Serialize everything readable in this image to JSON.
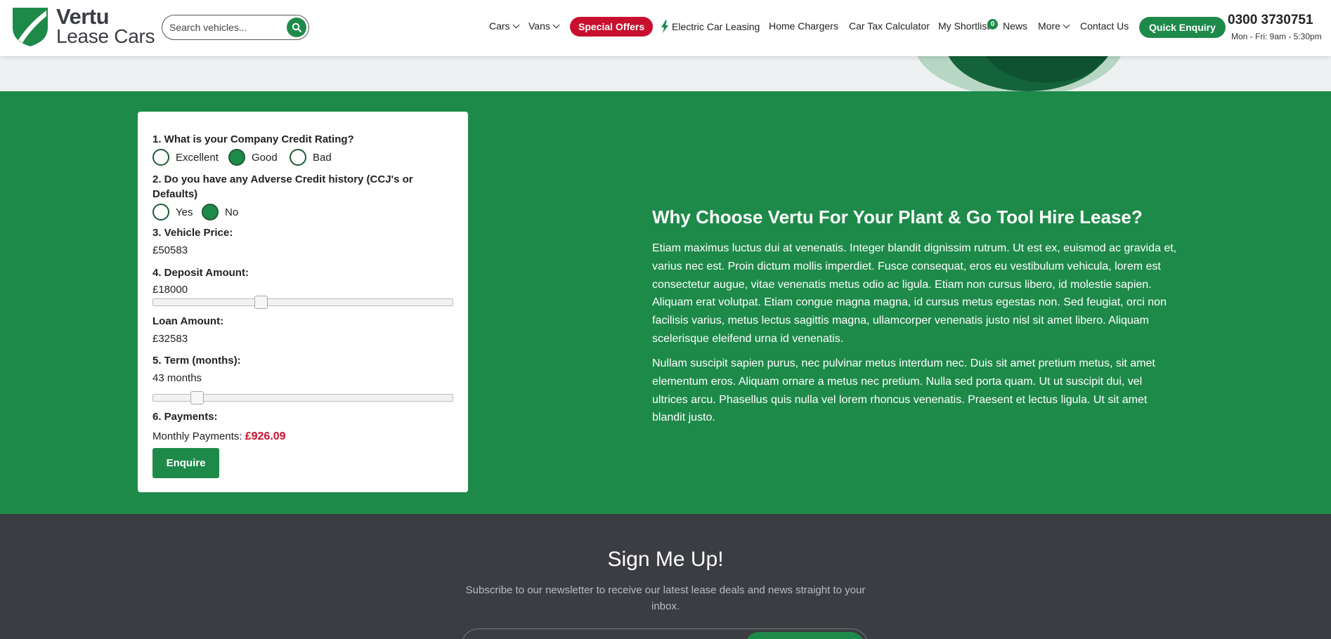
{
  "header": {
    "logo_line1": "Vertu",
    "logo_line2": "Lease Cars",
    "search_placeholder": "Search vehicles...",
    "nav": {
      "cars": "Cars",
      "vans": "Vans",
      "special_offers": "Special Offers",
      "electric": "Electric Car Leasing",
      "home_chargers": "Home Chargers",
      "car_tax": "Car Tax Calculator",
      "shortlist": "My Shortlist",
      "shortlist_count": "0",
      "news": "News",
      "more": "More",
      "contact": "Contact Us"
    },
    "quick_enquiry": "Quick Enquiry",
    "phone": "0300 3730751",
    "hours": "Mon - Fri: 9am - 5:30pm"
  },
  "calculator": {
    "q1": "1. What is your Company Credit Rating?",
    "q1_options": [
      "Excellent",
      "Good",
      "Bad"
    ],
    "q1_selected": "Good",
    "q2": "2. Do you have any Adverse Credit history (CCJ's or Defaults)",
    "q2_options": [
      "Yes",
      "No"
    ],
    "q2_selected": "No",
    "q3": "3. Vehicle Price:",
    "vehicle_price": "£50583",
    "q4": "4. Deposit Amount:",
    "deposit": "£18000",
    "deposit_slider_fraction": 0.36,
    "loan_label": "Loan Amount:",
    "loan": "£32583",
    "q5": "5. Term (months):",
    "term": "43 months",
    "term_slider_fraction": 0.145,
    "q6": "6. Payments:",
    "monthly_label": "Monthly Payments:",
    "monthly_amount": "£926.09",
    "enquire": "Enquire"
  },
  "why": {
    "title": "Why Choose Vertu For Your Plant & Go Tool Hire Lease?",
    "p1": "Etiam maximus luctus dui at venenatis. Integer blandit dignissim rutrum. Ut est ex, euismod ac gravida et, varius nec est. Proin dictum mollis imperdiet. Fusce consequat, eros eu vestibulum vehicula, lorem est consectetur augue, vitae venenatis metus odio ac ligula. Etiam non cursus libero, id molestie sapien. Aliquam erat volutpat. Etiam congue magna magna, id cursus metus egestas non. Sed feugiat, orci non facilisis varius, metus lectus sagittis magna, ullamcorper venenatis justo nisl sit amet libero. Aliquam scelerisque eleifend urna id venenatis.",
    "p2": "Nullam suscipit sapien purus, nec pulvinar metus interdum nec. Duis sit amet pretium metus, sit amet elementum eros. Aliquam ornare a metus nec pretium. Nulla sed porta quam. Ut ut suscipit dui, vel ultrices arcu. Phasellus quis nulla vel lorem rhoncus venenatis. Praesent et lectus ligula. Ut sit amet blandit justo."
  },
  "newsletter": {
    "title": "Sign Me Up!",
    "subtitle": "Subscribe to our newsletter to receive our latest lease deals and news straight to your inbox."
  },
  "colors": {
    "brand_green": "#1e8a4a",
    "offer_red": "#c8102e",
    "footer_dark": "#3b3d42"
  }
}
